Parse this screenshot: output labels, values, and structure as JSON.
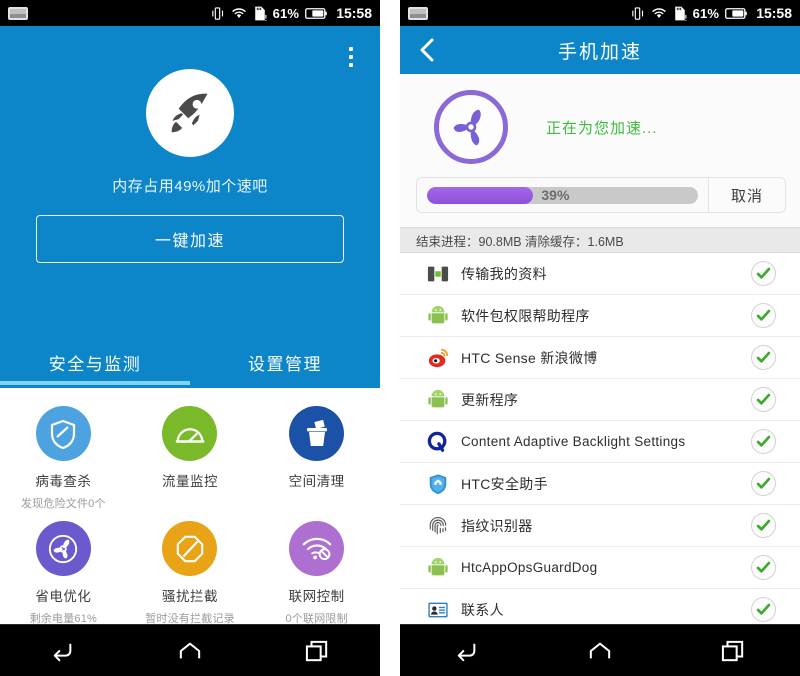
{
  "status_bar": {
    "keyboard_icon": "keyboard-icon",
    "vibrate_icon": "vibrate-icon",
    "wifi_icon": "wifi-icon",
    "sd_card_icon": "sd-card-warning-icon",
    "battery_percent": "61%",
    "battery_icon": "battery-icon",
    "time": "15:58"
  },
  "left_phone": {
    "overflow_menu": "overflow-menu",
    "rocket_icon": "rocket-icon",
    "memory_hint": "内存占用49%加个速吧",
    "boost_button": "一键加速",
    "tabs": [
      {
        "label": "安全与监测",
        "active": true
      },
      {
        "label": "设置管理",
        "active": false
      }
    ],
    "tools": [
      {
        "label": "病毒查杀",
        "sub": "发现危险文件0个",
        "icon": "shield-icon",
        "color": "#4da3e0"
      },
      {
        "label": "流量监控",
        "sub": "",
        "icon": "gauge-icon",
        "color": "#7ab929"
      },
      {
        "label": "空间清理",
        "sub": "",
        "icon": "trash-icon",
        "color": "#1b52a8"
      },
      {
        "label": "省电优化",
        "sub": "剩余电量61%",
        "icon": "fan-icon",
        "color": "#6a5acd"
      },
      {
        "label": "骚扰拦截",
        "sub": "暂时没有拦截记录",
        "icon": "block-icon",
        "color": "#e8a317"
      },
      {
        "label": "联网控制",
        "sub": "0个联网限制",
        "icon": "wifi-block-icon",
        "color": "#ad6fd0"
      }
    ]
  },
  "right_phone": {
    "back_icon": "back-chevron-icon",
    "title": "手机加速",
    "fan_icon": "fan-icon",
    "status_text": "正在为您加速...",
    "progress_percent": "39%",
    "progress_value": 39,
    "cancel_label": "取消",
    "summary": "结束进程：90.8MB  清除缓存：1.6MB",
    "apps": [
      {
        "name": "传输我的资料",
        "icon": "transfer-icon",
        "checked": true,
        "latin": false
      },
      {
        "name": "软件包权限帮助程序",
        "icon": "android-icon",
        "checked": true,
        "latin": false
      },
      {
        "name": "HTC Sense 新浪微博",
        "icon": "weibo-icon",
        "checked": true,
        "latin": false
      },
      {
        "name": "更新程序",
        "icon": "android-icon",
        "checked": true,
        "latin": false
      },
      {
        "name": "Content Adaptive Backlight Settings",
        "icon": "qualcomm-icon",
        "checked": true,
        "latin": true
      },
      {
        "name": "HTC安全助手",
        "icon": "htc-shield-icon",
        "checked": true,
        "latin": false
      },
      {
        "name": "指纹识别器",
        "icon": "fingerprint-icon",
        "checked": true,
        "latin": false
      },
      {
        "name": "HtcAppOpsGuardDog",
        "icon": "android-icon",
        "checked": true,
        "latin": true
      },
      {
        "name": "联系人",
        "icon": "contacts-icon",
        "checked": true,
        "latin": false
      }
    ]
  },
  "nav_bar": {
    "back": "back-icon",
    "home": "home-icon",
    "recents": "recents-icon"
  },
  "colors": {
    "brand_blue": "#0c86c8",
    "tab_underline": "#7fd3f5",
    "progress_purple": "#8e4fdc",
    "status_green": "#3fbb3f",
    "check_green": "#3aab2b"
  }
}
